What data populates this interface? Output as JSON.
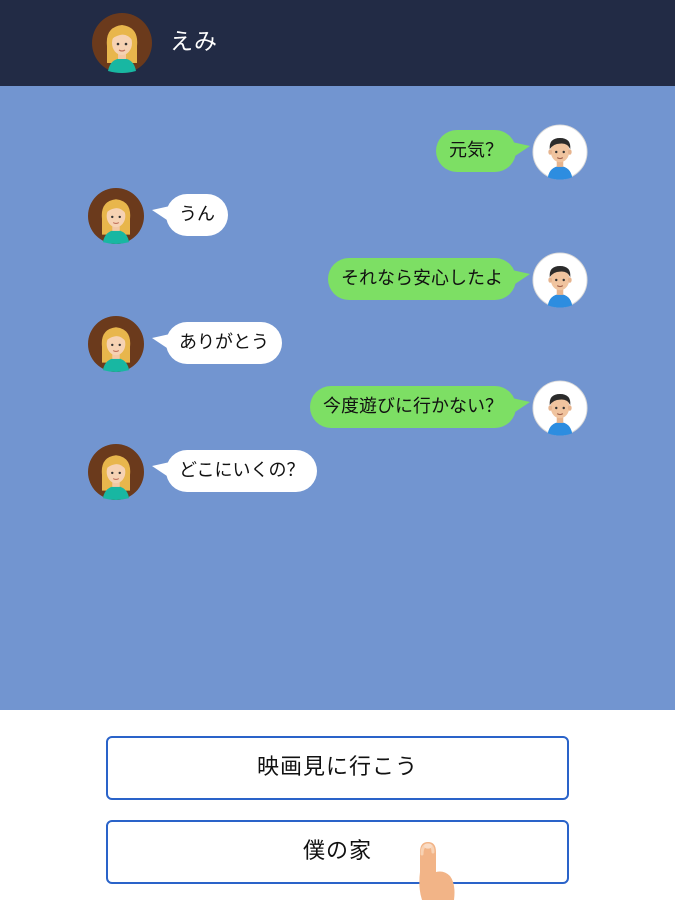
{
  "header": {
    "contact_name": "えみ",
    "avatar_icon": "girl-avatar-icon",
    "background_color": "#222b45"
  },
  "chat": {
    "background_color": "#7295d0",
    "sent_bubble_color": "#7ddf64",
    "received_bubble_color": "#ffffff",
    "messages": [
      {
        "sender": "me",
        "text": "元気？",
        "avatar_icon": "boy-avatar-icon"
      },
      {
        "sender": "emi",
        "text": "うん",
        "avatar_icon": "girl-avatar-icon"
      },
      {
        "sender": "me",
        "text": "それなら安心したよ",
        "avatar_icon": "boy-avatar-icon"
      },
      {
        "sender": "emi",
        "text": "ありがとう",
        "avatar_icon": "girl-avatar-icon"
      },
      {
        "sender": "me",
        "text": "今度遊びに行かない？",
        "avatar_icon": "boy-avatar-icon"
      },
      {
        "sender": "emi",
        "text": "どこにいくの？",
        "avatar_icon": "girl-avatar-icon"
      }
    ]
  },
  "replies": {
    "options": [
      "映画見に行こう",
      "僕の家"
    ],
    "border_color": "#2a63c9",
    "pointer_icon": "finger-pointer-icon"
  }
}
